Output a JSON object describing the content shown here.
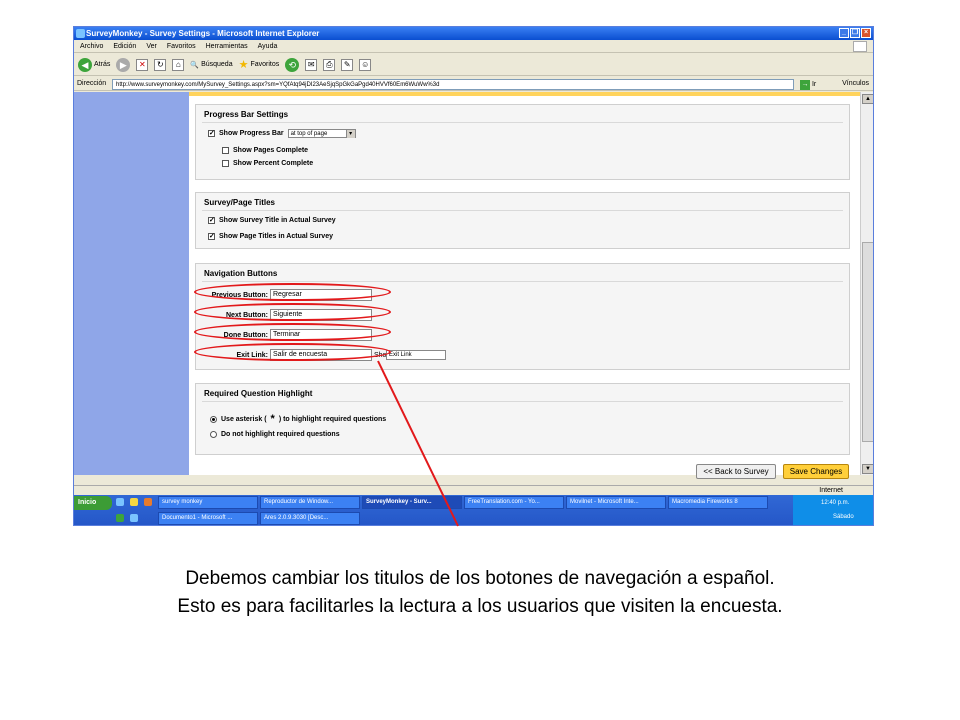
{
  "window": {
    "title": "SurveyMonkey - Survey Settings - Microsoft Internet Explorer",
    "buttons": [
      "_",
      "❐",
      "×"
    ]
  },
  "menu": [
    "Archivo",
    "Edición",
    "Ver",
    "Favoritos",
    "Herramientas",
    "Ayuda"
  ],
  "toolbar": {
    "back": "Atrás",
    "search": "Búsqueda",
    "favorites": "Favoritos"
  },
  "address": {
    "label": "Dirección",
    "url": "http://www.surveymonkey.com/MySurvey_Settings.aspx?sm=YQfAtq94jDI23AeSjqSpGkGaPgd40HVVf60Em6WuWw%3d",
    "go": "Ir",
    "links": "Vínculos"
  },
  "progress": {
    "title": "Progress Bar Settings",
    "show_bar": "Show Progress Bar",
    "position": "at top of page",
    "pages_complete": "Show Pages Complete",
    "percent_complete": "Show Percent Complete"
  },
  "titles": {
    "title": "Survey/Page Titles",
    "survey_title": "Show Survey Title in Actual Survey",
    "page_titles": "Show Page Titles in Actual Survey"
  },
  "nav": {
    "title": "Navigation Buttons",
    "prev_label": "Previous Button:",
    "prev_value": "Regresar",
    "next_label": "Next Button:",
    "next_value": "Siguiente",
    "done_label": "Done Button:",
    "done_value": "Terminar",
    "exit_label": "Exit Link:",
    "exit_value": "Salir de encuesta",
    "exit_show": "Sho",
    "exit_select": "Exit Link"
  },
  "required": {
    "title": "Required Question Highlight",
    "opt1_a": "Use asterisk (",
    "opt1_star": "*",
    "opt1_b": ") to highlight required questions",
    "opt2": "Do not highlight required questions"
  },
  "buttons": {
    "back": "<< Back to Survey",
    "save": "Save Changes"
  },
  "status": {
    "zone": "Internet"
  },
  "taskbar": {
    "start": "Inicio",
    "row1": [
      "survey monkey",
      "Reproductor de Window...",
      "SurveyMonkey - Surv...",
      "FreeTranslation.com - Yo...",
      "Movilnet - Microsoft Inte...",
      "Macromedia Fireworks 8"
    ],
    "row2": [
      "Documento1 - Microsoft ...",
      "Ares 2.0.9.3030  [Desc..."
    ],
    "time": "12:40 p.m.",
    "day": "Sábado"
  },
  "caption": {
    "line1": "Debemos cambiar los titulos de los botones de navegación a español.",
    "line2": "Esto es para facilitarles la lectura a los usuarios que visiten la encuesta."
  },
  "colors": {
    "highlight": "#e2191b",
    "save_button": "#ffcf3a",
    "left_panel": "#8fa6e8"
  }
}
